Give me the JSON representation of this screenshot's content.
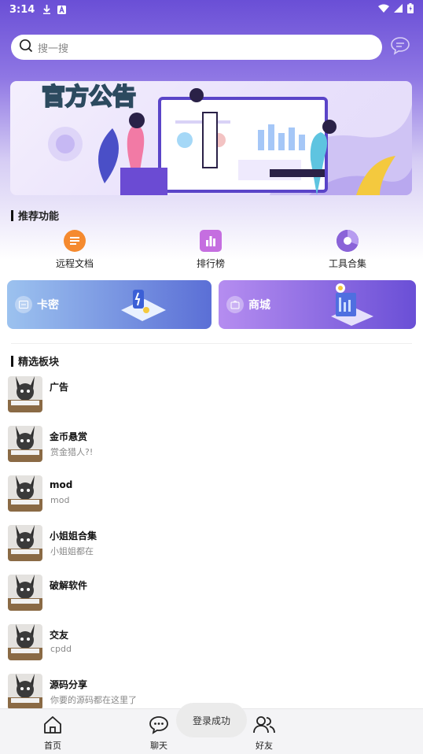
{
  "status_bar": {
    "time": "3:14"
  },
  "search": {
    "placeholder": "搜一搜"
  },
  "banner": {
    "title": "官方公告"
  },
  "recommended": {
    "title": "推荐功能",
    "items": [
      {
        "label": "远程文档",
        "color": "#f58a2f"
      },
      {
        "label": "排行榜",
        "color": "#c56ee0"
      },
      {
        "label": "工具合集",
        "color": "#8a63d8"
      }
    ]
  },
  "cards": [
    {
      "label": "卡密",
      "colors": [
        "#9cc2ef",
        "#5b6fd6"
      ]
    },
    {
      "label": "商城",
      "colors": [
        "#b58df0",
        "#6a4fd6"
      ]
    }
  ],
  "featured": {
    "title": "精选板块",
    "boards": [
      {
        "title": "广告",
        "subtitle": ""
      },
      {
        "title": "金币悬赏",
        "subtitle": "赏金猎人?!"
      },
      {
        "title": "mod",
        "subtitle": "mod"
      },
      {
        "title": "小姐姐合集",
        "subtitle": "小姐姐都在"
      },
      {
        "title": "破解软件",
        "subtitle": ""
      },
      {
        "title": "交友",
        "subtitle": "cpdd"
      },
      {
        "title": "源码分享",
        "subtitle": "你要的源码都在这里了"
      }
    ]
  },
  "bottom_nav": {
    "home": "首页",
    "chat": "聊天",
    "friends": "好友"
  },
  "toast": "登录成功"
}
